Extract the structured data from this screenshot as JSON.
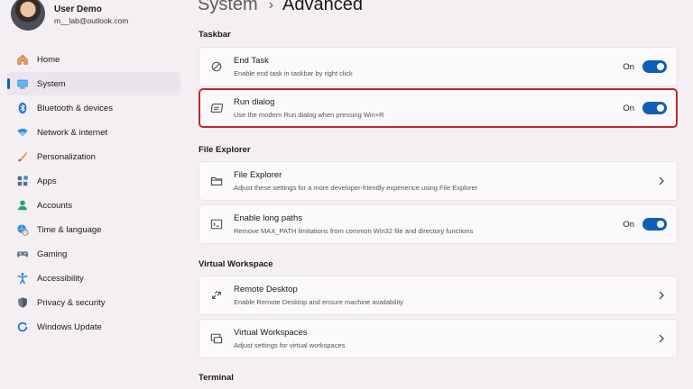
{
  "profile": {
    "name": "User Demo",
    "email": "m__lab@outlook.com"
  },
  "nav": {
    "items": [
      {
        "label": "Home",
        "icon": "home-icon"
      },
      {
        "label": "System",
        "icon": "system-icon",
        "selected": true
      },
      {
        "label": "Bluetooth & devices",
        "icon": "bluetooth-icon"
      },
      {
        "label": "Network & internet",
        "icon": "wifi-icon"
      },
      {
        "label": "Personalization",
        "icon": "brush-icon"
      },
      {
        "label": "Apps",
        "icon": "apps-icon"
      },
      {
        "label": "Accounts",
        "icon": "accounts-icon"
      },
      {
        "label": "Time & language",
        "icon": "globe-clock-icon"
      },
      {
        "label": "Gaming",
        "icon": "gaming-icon"
      },
      {
        "label": "Accessibility",
        "icon": "accessibility-icon"
      },
      {
        "label": "Privacy & security",
        "icon": "shield-icon"
      },
      {
        "label": "Windows Update",
        "icon": "update-icon"
      }
    ]
  },
  "header": {
    "parent": "System",
    "separator": "›",
    "current": "Advanced"
  },
  "sections": {
    "taskbar": "Taskbar",
    "file_explorer": "File Explorer",
    "virtual_workspace": "Virtual Workspace",
    "terminal": "Terminal"
  },
  "cards": {
    "end_task": {
      "title": "End Task",
      "desc": "Enable end task in taskbar by right click",
      "state": "On",
      "icon": "end-task-icon"
    },
    "run_dialog": {
      "title": "Run dialog",
      "desc": "Use the modern Run dialog when pressing Win+R",
      "state": "On",
      "icon": "run-dialog-icon"
    },
    "file_explorer": {
      "title": "File Explorer",
      "desc": "Adjust these settings for a more developer-friendly experience using File Explorer",
      "icon": "folder-icon"
    },
    "long_paths": {
      "title": "Enable long paths",
      "desc": "Remove MAX_PATH limitations from common Win32 file and directory functions",
      "state": "On",
      "icon": "long-paths-icon"
    },
    "remote_desktop": {
      "title": "Remote Desktop",
      "desc": "Enable Remote Desktop and ensure machine availability",
      "icon": "remote-desktop-icon"
    },
    "virtual_workspaces": {
      "title": "Virtual Workspaces",
      "desc": "Adjust settings for virtual workspaces",
      "icon": "virtual-workspaces-icon"
    }
  },
  "colors": {
    "accent": "#0f5fb8",
    "highlight_border": "#c4262e",
    "background": "#f3eff3",
    "card": "#fbf9fb"
  }
}
